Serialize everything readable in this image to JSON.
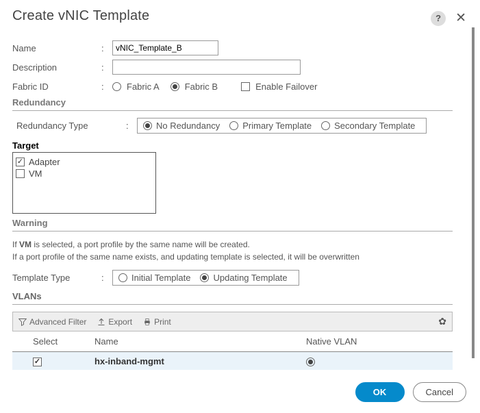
{
  "header": {
    "title": "Create vNIC Template"
  },
  "form": {
    "name_label": "Name",
    "name_value": "vNIC_Template_B",
    "desc_label": "Description",
    "desc_value": "",
    "fabric_label": "Fabric ID",
    "fabric_a": "Fabric A",
    "fabric_b": "Fabric B",
    "enable_failover": "Enable Failover",
    "fabric_selected": "B",
    "failover_checked": false
  },
  "redundancy": {
    "section": "Redundancy",
    "type_label": "Redundancy Type",
    "options": {
      "none": "No Redundancy",
      "primary": "Primary Template",
      "secondary": "Secondary Template"
    },
    "selected": "none"
  },
  "target": {
    "label": "Target",
    "adapter": "Adapter",
    "vm": "VM",
    "adapter_checked": true,
    "vm_checked": false
  },
  "warning": {
    "title": "Warning",
    "line1_pre": "If ",
    "line1_bold": "VM",
    "line1_post": " is selected, a port profile by the same name will be created.",
    "line2": "If a port profile of the same name exists, and updating template is selected, it will be overwritten"
  },
  "template_type": {
    "label": "Template Type",
    "initial": "Initial Template",
    "updating": "Updating Template",
    "selected": "updating"
  },
  "vlans": {
    "section": "VLANs",
    "toolbar": {
      "filter": "Advanced Filter",
      "export": "Export",
      "print": "Print"
    },
    "columns": {
      "select": "Select",
      "name": "Name",
      "native": "Native VLAN"
    },
    "rows": [
      {
        "selected": true,
        "name": "hx-inband-mgmt",
        "native": true
      }
    ]
  },
  "buttons": {
    "ok": "OK",
    "cancel": "Cancel"
  }
}
